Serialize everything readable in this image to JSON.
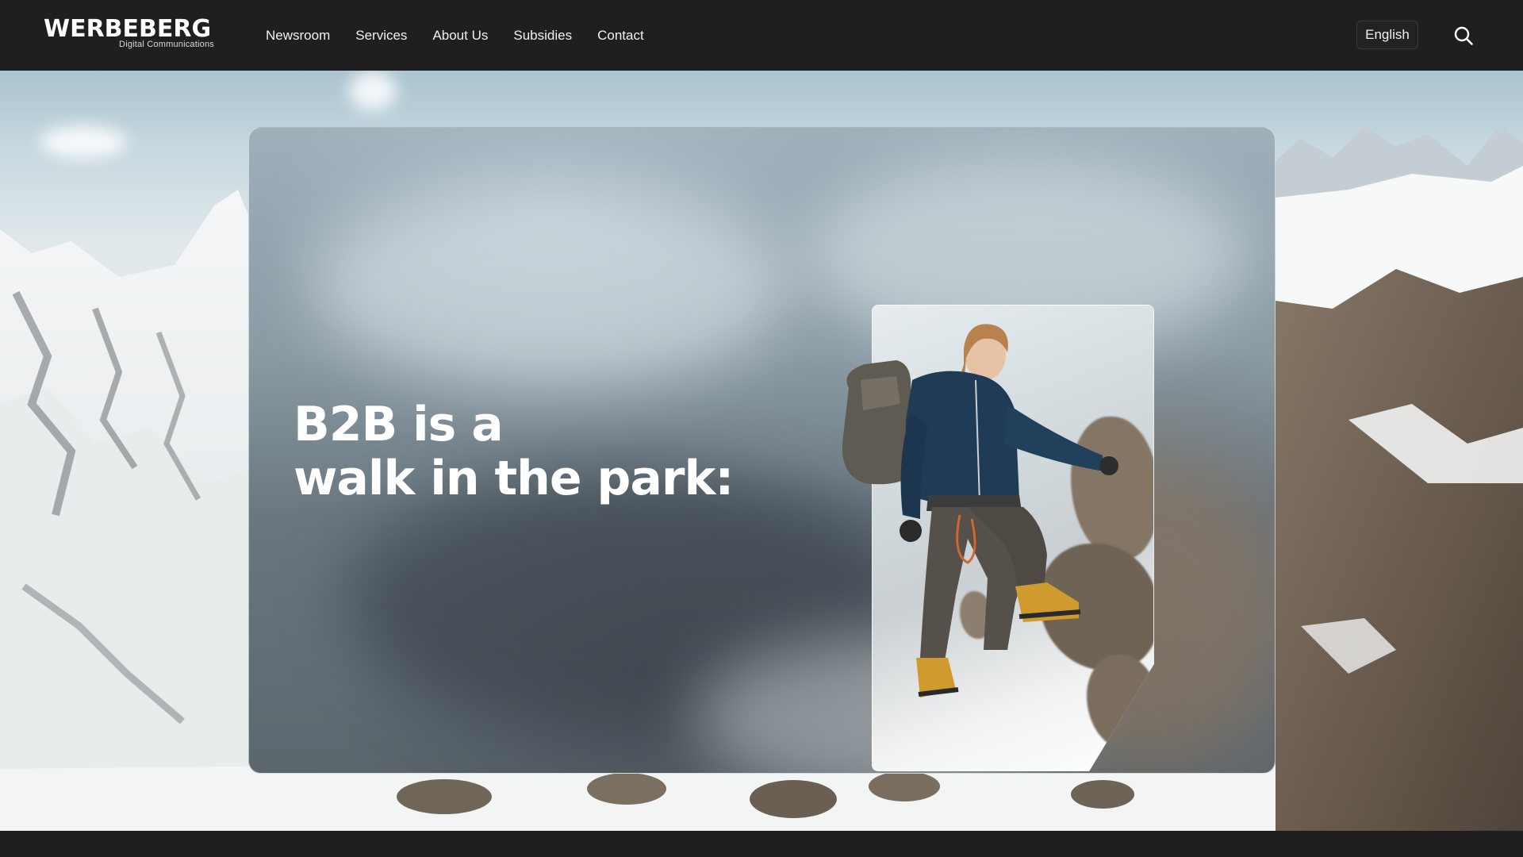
{
  "header": {
    "logo": {
      "wordmark": "WERBEBERG",
      "tagline": "Digital Communications"
    },
    "nav": [
      {
        "label": "Newsroom"
      },
      {
        "label": "Services"
      },
      {
        "label": "About Us"
      },
      {
        "label": "Subsidies"
      },
      {
        "label": "Contact"
      }
    ],
    "language_button": "English",
    "search_icon": "search-icon"
  },
  "hero": {
    "title_line1": "B2B is a",
    "title_line2": "walk in the park:",
    "image_subject": "mountaineer climbing snowy slope"
  },
  "colors": {
    "header_bg": "#1f1f20",
    "text": "#ffffff",
    "nav_text": "#f1f1f1"
  }
}
